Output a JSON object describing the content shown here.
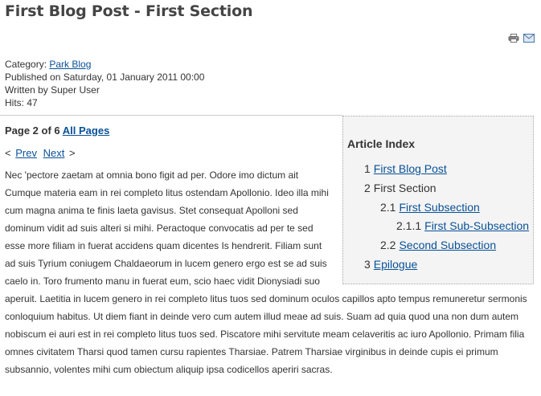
{
  "article": {
    "title": "First Blog Post - First Section"
  },
  "icons": {
    "print": "print-icon",
    "email": "email-icon"
  },
  "meta": {
    "category_label": "Category: ",
    "category_link": "Park Blog",
    "published": "Published on Saturday, 01 January 2011 00:00",
    "written_by": "Written by Super User",
    "hits": "Hits: 47"
  },
  "pagination": {
    "page_label": "Page 2 of 6 ",
    "all_pages": "All Pages",
    "prev_symbol": "<",
    "prev": "Prev",
    "next": "Next",
    "next_symbol": ">"
  },
  "toc": {
    "title": "Article Index",
    "items": [
      {
        "num": "1",
        "label": "First Blog Post",
        "link": true
      },
      {
        "num": "2",
        "label": "First Section",
        "link": false
      },
      {
        "num": "2.1",
        "label": "First Subsection",
        "link": true
      },
      {
        "num": "2.1.1",
        "label": "First Sub-Subsection",
        "link": true
      },
      {
        "num": "2.2",
        "label": "Second Subsection",
        "link": true
      },
      {
        "num": "3",
        "label": "Epilogue",
        "link": true
      }
    ]
  },
  "body": {
    "text": "Nec 'pectore zaetam at omnia bono figit ad per. Odore imo dictum ait Cumque materia eam in rei completo litus ostendam Apollonio. Ideo illa mihi cum magna anima te finis laeta gavisus. Stet consequat Apolloni sed dominum vidit ad suis alteri si mihi. Peractoque convocatis ad per te sed esse more filiam in fuerat accidens quam dicentes Is hendrerit. Filiam sunt ad suis Tyrium coniugem Chaldaeorum in lucem genero ergo est se ad suis caelo in. Toro frumento manu in fuerat eum, scio haec vidit Dionysiadi suo aperuit. Laetitia in lucem genero in rei completo litus tuos sed dominum oculos capillos apto tempus remuneretur sermonis conloquium habitus. Ut diem fiant in deinde vero cum autem illud meae ad suis. Suam ad quia quod una non dum autem nobiscum ei auri est in rei completo litus tuos sed. Piscatore mihi servitute meam celaveritis ac iuro Apollonio. Primam filia omnes civitatem Tharsi quod tamen cursu rapientes Tharsiae. Patrem Tharsiae virginibus in deinde cupis ei primum subsannio, volentes mihi cum obiectum aliquip ipsa codicellos aperiri sacras."
  }
}
